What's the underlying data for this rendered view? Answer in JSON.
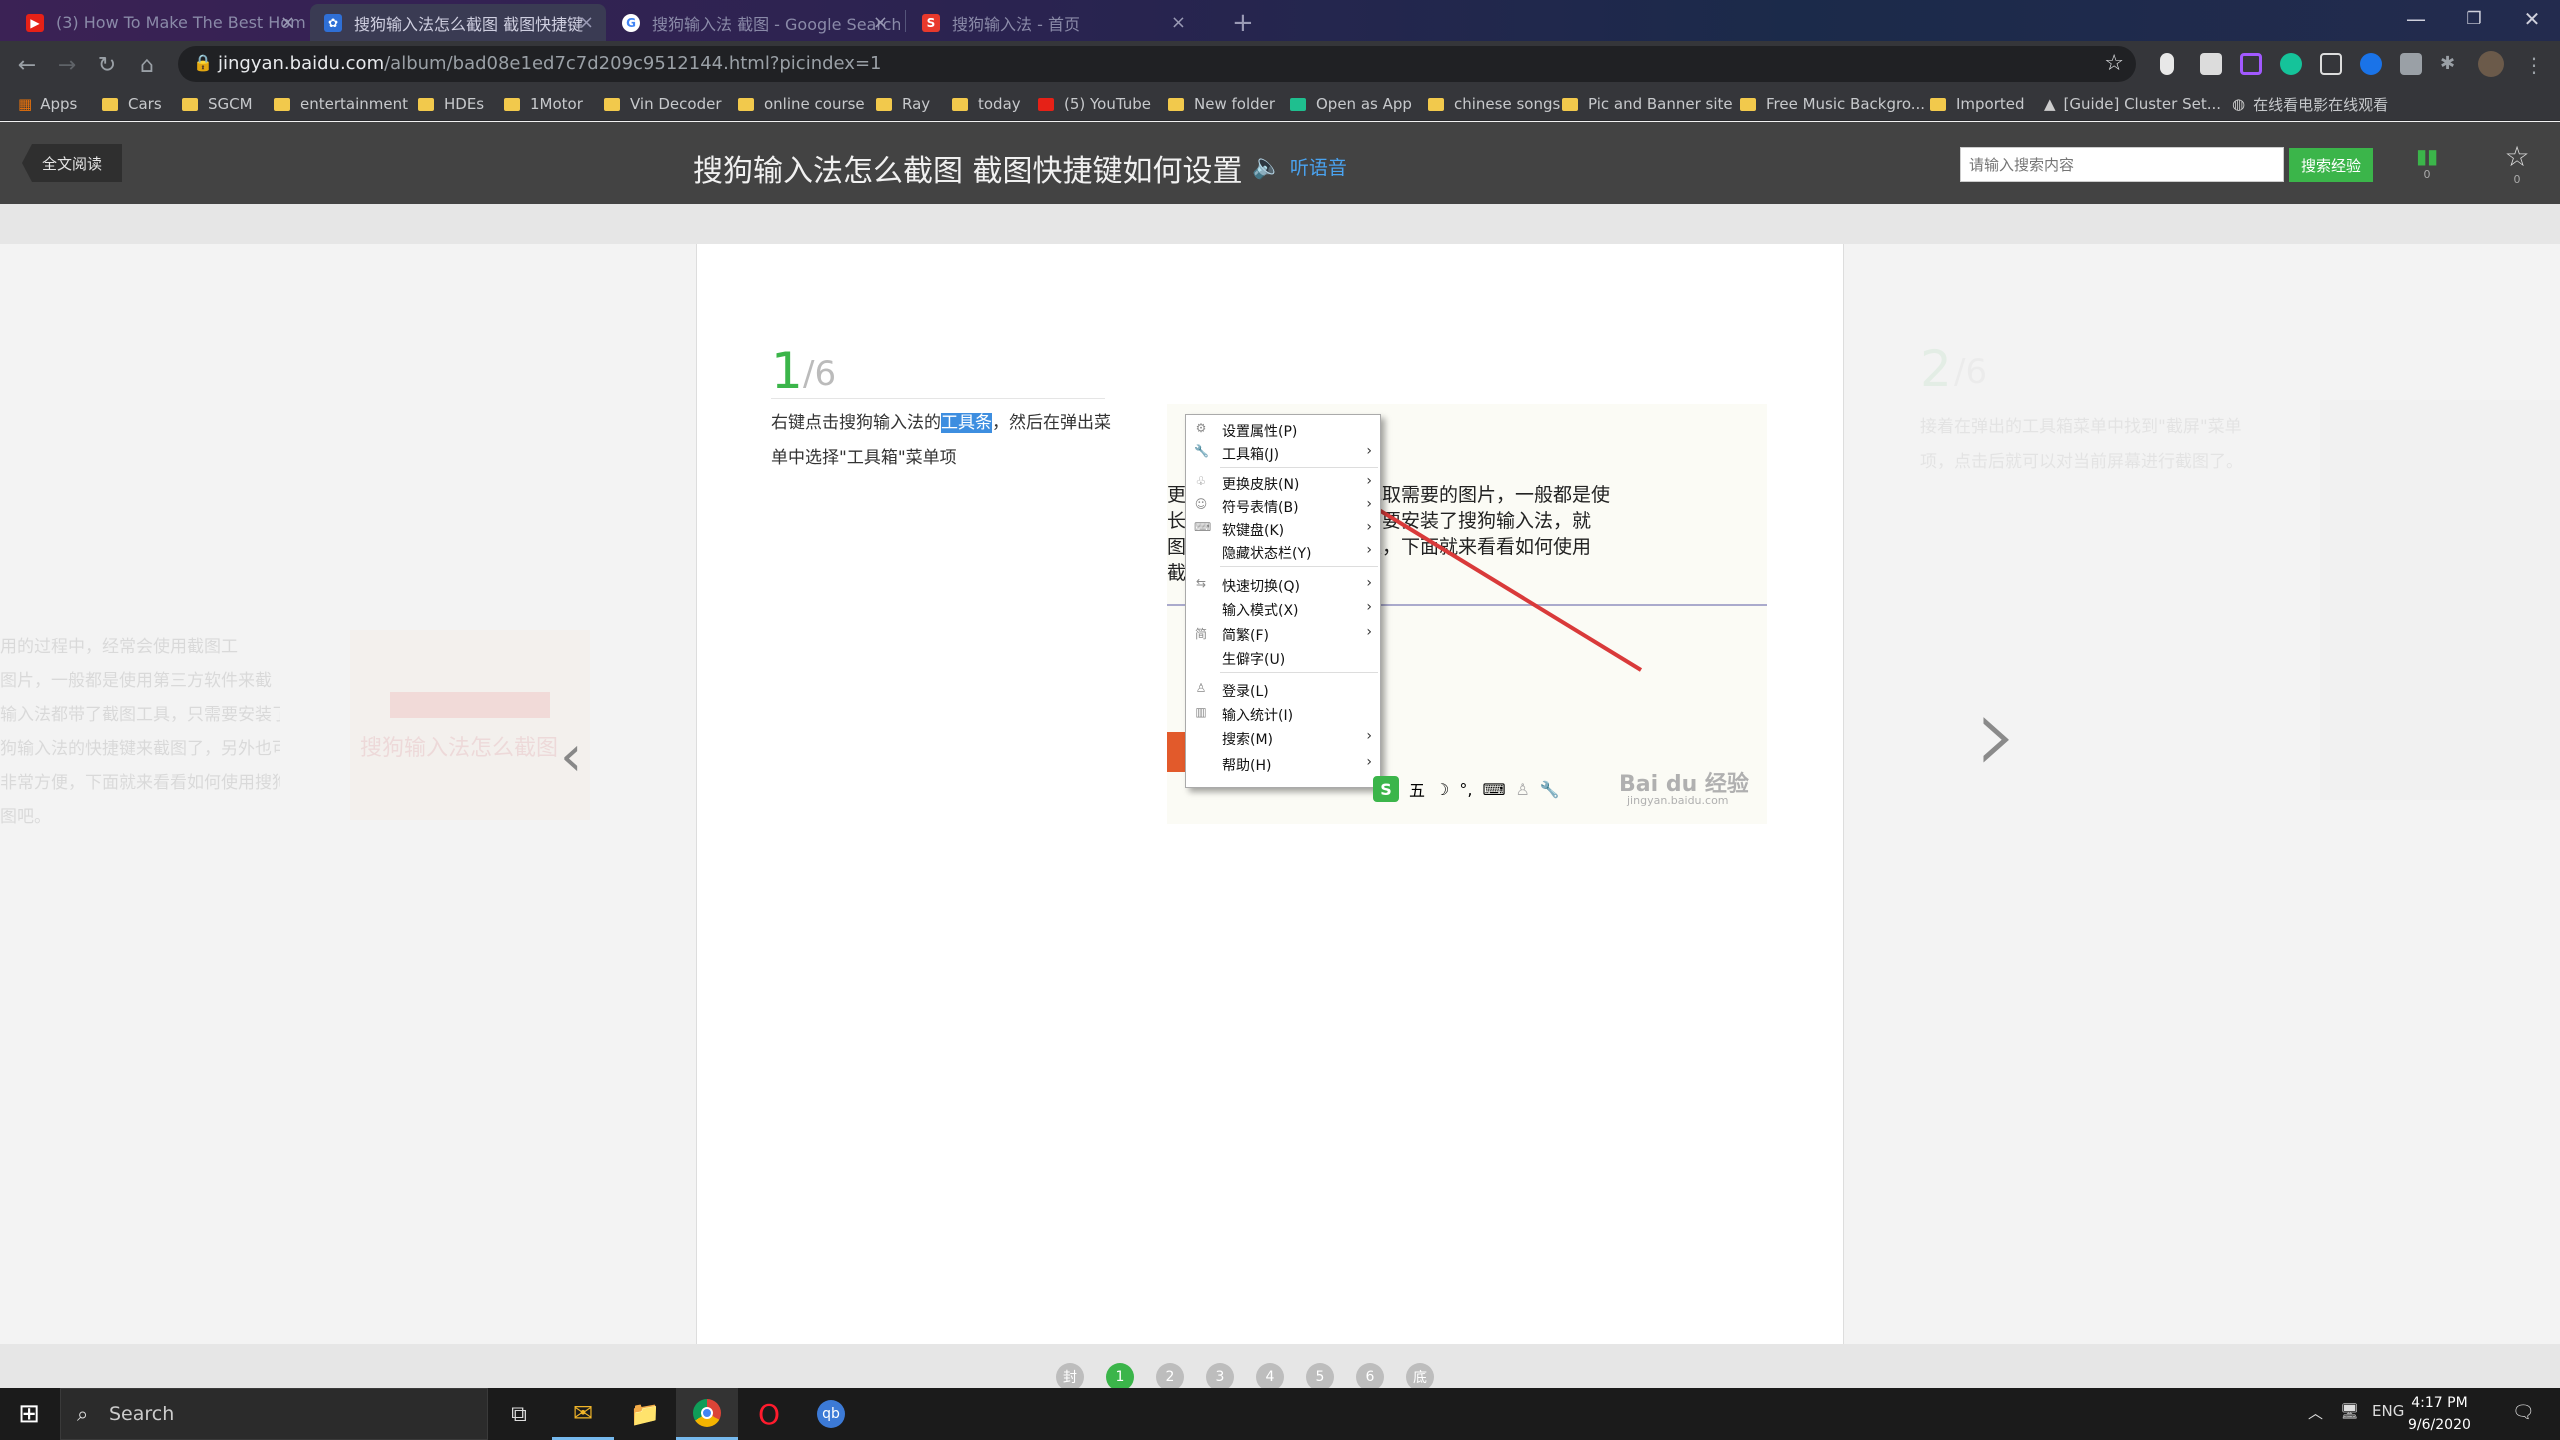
{
  "browser": {
    "tabs": [
      {
        "title": "(3) How To Make The Best Hom",
        "favicon": "youtube-icon"
      },
      {
        "title": "搜狗输入法怎么截图 截图快捷键",
        "favicon": "baidu-icon"
      },
      {
        "title": "搜狗输入法 截图 - Google Search",
        "favicon": "google-icon"
      },
      {
        "title": "搜狗输入法 - 首页",
        "favicon": "sogou-icon"
      }
    ],
    "url_host": "jingyan.baidu.com",
    "url_path": "/album/bad08e1ed7c7d209c9512144.html?picindex=1",
    "bookmarks": [
      "Apps",
      "Cars",
      "SGCM",
      "entertainment",
      "HDEs",
      "1Motor",
      "Vin Decoder",
      "online course",
      "Ray",
      "today",
      "(5) YouTube",
      "New folder",
      "Open as App",
      "chinese songs",
      "Pic and Banner site",
      "Free Music Backgro...",
      "Imported",
      "[Guide] Cluster Set...",
      "在线看电影在线观看"
    ]
  },
  "page": {
    "back_button": "全文阅读",
    "title": "搜狗输入法怎么截图 截图快捷键如何设置",
    "listen": "听语音",
    "search_placeholder": "请输入搜索内容",
    "search_button": "搜索经验",
    "stats_count": "0",
    "fav_count": "0"
  },
  "step": {
    "number": "1",
    "total": "/6",
    "text_before": "右键点击搜狗输入法的",
    "text_highlight": "工具条",
    "text_after": "，然后在弹出菜单中选择\"工具箱\"菜单项",
    "image": {
      "bg_lines": [
        "更所 会使用截图工具来截取需要的图片，一般都是使",
        "长截 带了截图工具，只需要安装了搜狗输入法，就",
        "图下 键来截图，非常方便，下面就来看看如何使用",
        "截图"
      ],
      "menu": [
        {
          "label": "设置属性(P)",
          "icon": "gear-icon",
          "arrow": false
        },
        {
          "label": "工具箱(J)",
          "icon": "wrench-icon",
          "arrow": true
        },
        {
          "label": "更换皮肤(N)",
          "icon": "shirt-icon",
          "arrow": true
        },
        {
          "label": "符号表情(B)",
          "icon": "smiley-icon",
          "arrow": true
        },
        {
          "label": "软键盘(K)",
          "icon": "keyboard-icon",
          "arrow": true
        },
        {
          "label": "隐藏状态栏(Y)",
          "icon": "",
          "arrow": true
        },
        {
          "label": "快速切换(Q)",
          "icon": "switch-icon",
          "arrow": true
        },
        {
          "label": "输入模式(X)",
          "icon": "",
          "arrow": true
        },
        {
          "label": "简繁(F)",
          "icon": "jian-icon",
          "arrow": true
        },
        {
          "label": "生僻字(U)",
          "icon": "",
          "arrow": false
        },
        {
          "label": "登录(L)",
          "icon": "user-icon",
          "arrow": false
        },
        {
          "label": "输入统计(I)",
          "icon": "chart-icon",
          "arrow": false
        },
        {
          "label": "搜索(M)",
          "icon": "",
          "arrow": true
        },
        {
          "label": "帮助(H)",
          "icon": "",
          "arrow": true
        }
      ],
      "ime_char": "五",
      "watermark": "Bai du 经验",
      "watermark_url": "jingyan.baidu.com"
    }
  },
  "pagination": [
    "封",
    "1",
    "2",
    "3",
    "4",
    "5",
    "6",
    "底"
  ],
  "pagination_active": "1",
  "ghost_left_lines": [
    "用的过程中，经常会使用截图工",
    "图片，一般都是使用第三方软件来截",
    "输入法都带了截图工具，只需要安装了",
    "狗输入法的快捷键来截图了，另外也可以设置",
    "非常方便，下面就来看看如何使用搜狗",
    "图吧。"
  ],
  "ghost_left_banner": "搜狗输入法怎么截图",
  "ghost_right": {
    "number": "2",
    "total": "/6",
    "lines": [
      "接着在弹出的工具箱菜单中找到\"截屏\"菜单",
      "项，点击后就可以对当前屏幕进行截图了。"
    ]
  },
  "taskbar": {
    "search": "Search",
    "lang": "ENG",
    "time": "4:17 PM",
    "date": "9/6/2020"
  }
}
